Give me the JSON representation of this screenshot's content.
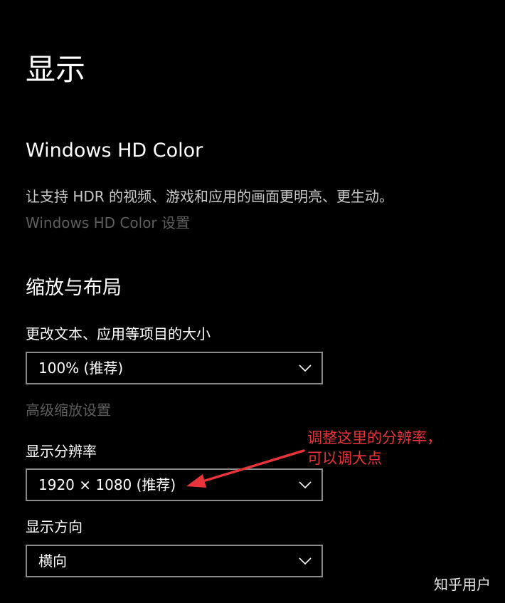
{
  "page": {
    "title": "显示"
  },
  "hd_color": {
    "title": "Windows HD Color",
    "description": "让支持 HDR 的视频、游戏和应用的画面更明亮、更生动。",
    "settings_link": "Windows HD Color 设置"
  },
  "scale_layout": {
    "title": "缩放与布局",
    "scale_label": "更改文本、应用等项目的大小",
    "scale_value": "100% (推荐)",
    "advanced_link": "高级缩放设置",
    "resolution_label": "显示分辨率",
    "resolution_value": "1920 × 1080 (推荐)",
    "orientation_label": "显示方向",
    "orientation_value": "横向"
  },
  "annotation": {
    "line1": "调整这里的分辨率，",
    "line2": "可以调大点"
  },
  "watermark": "知乎用户",
  "colors": {
    "background": "#000000",
    "text": "#ffffff",
    "muted": "#c8c8c8",
    "disabled": "#5e5e5e",
    "border": "#8a8a8a",
    "annotation_red": "#e8343a"
  },
  "icons": {
    "dropdown": "chevron-down-icon",
    "annotation_arrow": "arrow-icon"
  }
}
